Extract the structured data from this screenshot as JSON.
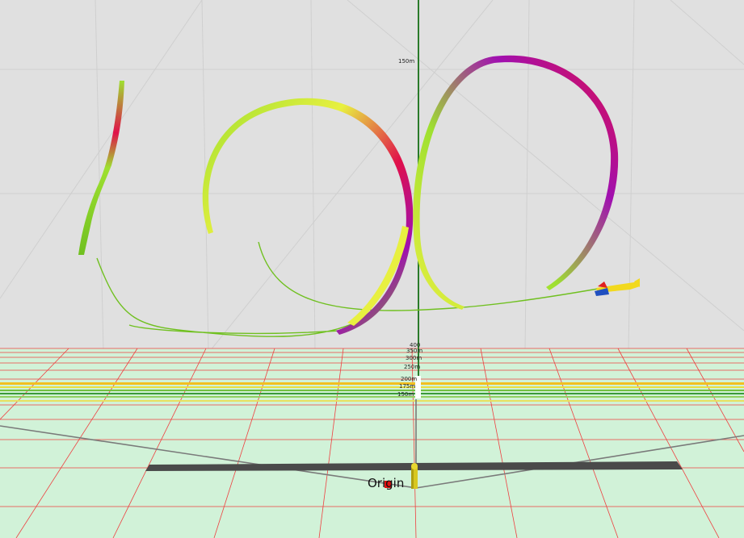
{
  "scene": {
    "sky_color": "#e0e0e0",
    "ground_color": "#d1f2d8",
    "grid_color": "#cfcfcf",
    "ground_grid_color": "#ee4040",
    "mast_color": "#2a7a2a",
    "runway_color": "#4a4a4a",
    "origin_label": "Origin",
    "mast_top_label": "150m",
    "altitude_labels": [
      "400",
      "350m",
      "300m",
      "250m",
      "200m",
      "175m",
      "150m"
    ]
  },
  "flight_trail": {
    "ribbon_colors": [
      "#9ee030",
      "#e8f040",
      "#e0104a",
      "#a010b0",
      "#70c020"
    ]
  },
  "aircraft": {
    "body_color": "#f2d91e",
    "tail_color": "#e02020",
    "wing_color": "#2050c0"
  }
}
